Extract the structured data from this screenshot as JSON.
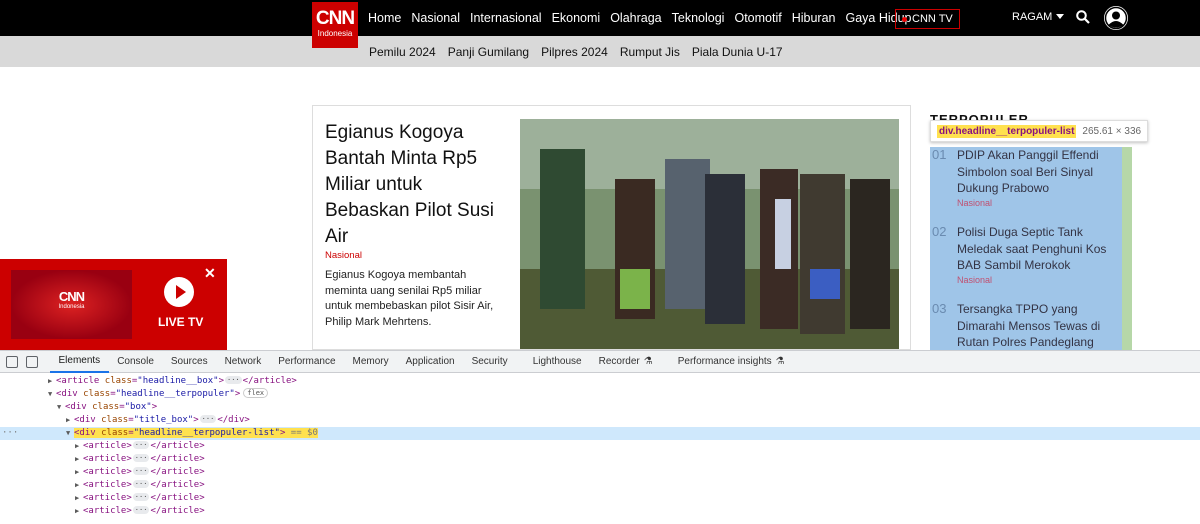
{
  "site": {
    "logo_main": "CNN",
    "logo_sub": "Indonesia",
    "nav": [
      "Home",
      "Nasional",
      "Internasional",
      "Ekonomi",
      "Olahraga",
      "Teknologi",
      "Otomotif",
      "Hiburan",
      "Gaya Hidup"
    ],
    "cnn_tv": "CNN TV",
    "ragam": "RAGAM",
    "subnav": [
      "Pemilu 2024",
      "Panji Gumilang",
      "Pilpres 2024",
      "Rumput Jis",
      "Piala Dunia U-17"
    ]
  },
  "headline": {
    "title": "Egianus Kogoya Bantah Minta Rp5 Miliar untuk Bebaskan Pilot Susi Air",
    "category": "Nasional",
    "description": "Egianus Kogoya membantah meminta uang senilai Rp5 miliar untuk membebaskan pilot Sisir Air, Philip Mark Mehrtens."
  },
  "terpopuler": {
    "title": "TERPOPULER",
    "tooltip_selector": "div.headline__terpopuler-list",
    "tooltip_dims": "265.61 × 336",
    "items": [
      {
        "num": "01",
        "title": "PDIP Akan Panggil Effendi Simbolon soal Beri Sinyal Dukung Prabowo",
        "category": "Nasional"
      },
      {
        "num": "02",
        "title": "Polisi Duga Septic Tank Meledak saat Penghuni Kos BAB Sambil Merokok",
        "category": "Nasional"
      },
      {
        "num": "03",
        "title": "Tersangka TPPO yang Dimarahi Mensos Tewas di Rutan Polres Pandeglang",
        "category": ""
      }
    ]
  },
  "livetv": {
    "label": "LIVE TV",
    "close": "✕",
    "logo_main": "CNN",
    "logo_sub": "Indonesia"
  },
  "devtools": {
    "tabs": [
      "Elements",
      "Console",
      "Sources",
      "Network",
      "Performance",
      "Memory",
      "Application",
      "Security",
      "Lighthouse",
      "Recorder",
      "Performance insights"
    ],
    "flask_icon": "⚗",
    "dom": {
      "l1": {
        "tag": "article",
        "attr": "class",
        "val": "\"headline__box\"",
        "close": "</article>"
      },
      "l2": {
        "tag": "div",
        "attr": "class",
        "val": "\"headline__terpopuler\"",
        "badge": "flex"
      },
      "l3": {
        "tag": "div",
        "attr": "class",
        "val": "\"box\""
      },
      "l4": {
        "tag": "div",
        "attr": "class",
        "val": "\"title_box\"",
        "close": "</div>"
      },
      "l5": {
        "tag": "div",
        "attr": "class",
        "val": "\"headline__terpopuler-list\"",
        "suffix": "== $0"
      },
      "article_open": "<article>",
      "article_close": "</article>",
      "ellipsis": "···",
      "gutter": "···"
    }
  },
  "colors": {
    "brand_red": "#cc0000",
    "highlight_blue": "#9fc5e8",
    "highlight_green": "#b6d7a8",
    "selection_yellow": "#ffe14f"
  }
}
